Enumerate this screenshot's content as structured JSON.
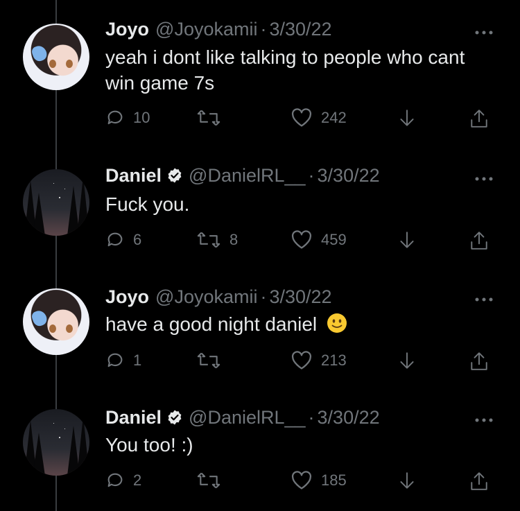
{
  "tweets": [
    {
      "name": "Joyo",
      "handle": "@Joyokamii",
      "separator": "·",
      "date": "3/30/22",
      "text": "yeah i dont like talking to people who cant win game 7s",
      "replies": "10",
      "retweets": "",
      "likes": "242",
      "avatar": "anime-girl-avatar",
      "verified": false
    },
    {
      "name": "Daniel",
      "handle": "@DanielRL__",
      "separator": "·",
      "date": "3/30/22",
      "text": "Fuck you.",
      "replies": "6",
      "retweets": "8",
      "likes": "459",
      "avatar": "night-sky-forest-avatar",
      "verified": true
    },
    {
      "name": "Joyo",
      "handle": "@Joyokamii",
      "separator": "·",
      "date": "3/30/22",
      "text": "have a good night daniel",
      "emoji": "slightly-smiling-face",
      "replies": "1",
      "retweets": "",
      "likes": "213",
      "avatar": "anime-girl-avatar",
      "verified": false
    },
    {
      "name": "Daniel",
      "handle": "@DanielRL__",
      "separator": "·",
      "date": "3/30/22",
      "text": "You too! :)",
      "replies": "2",
      "retweets": "",
      "likes": "185",
      "avatar": "night-sky-forest-avatar",
      "verified": true
    }
  ],
  "colors": {
    "background": "#000000",
    "text": "#e7e9ea",
    "secondary": "#71767b",
    "thread_line": "#3a3d40"
  }
}
